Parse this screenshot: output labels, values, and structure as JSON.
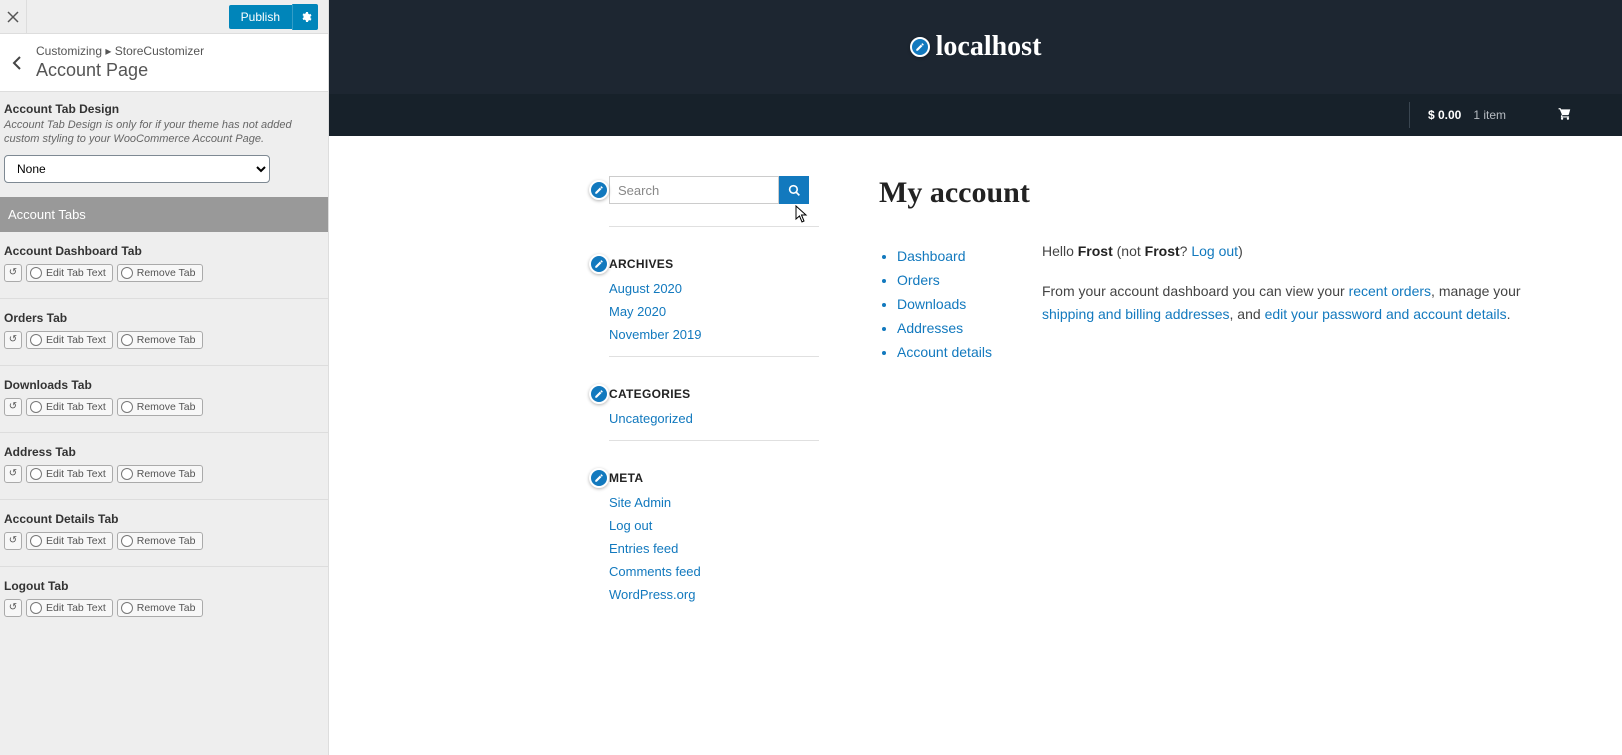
{
  "sidebar": {
    "publish": "Publish",
    "breadcrumb_prefix": "Customizing",
    "breadcrumb_section": "StoreCustomizer",
    "title": "Account Page",
    "design": {
      "label": "Account Tab Design",
      "desc": "Account Tab Design is only for if your theme has not added custom styling to your WooCommerce Account Page.",
      "value": "None"
    },
    "tabs_header": "Account Tabs",
    "edit_label": "Edit Tab Text",
    "remove_label": "Remove Tab",
    "tabs": [
      {
        "title": "Account Dashboard Tab"
      },
      {
        "title": "Orders Tab"
      },
      {
        "title": "Downloads Tab"
      },
      {
        "title": "Address Tab"
      },
      {
        "title": "Account Details Tab"
      },
      {
        "title": "Logout Tab"
      }
    ]
  },
  "site": {
    "name": "localhost",
    "cart_price": "$ 0.00",
    "cart_items": "1 item"
  },
  "widgets": {
    "search_placeholder": "Search",
    "archives": {
      "title": "ARCHIVES",
      "items": [
        "August 2020",
        "May 2020",
        "November 2019"
      ]
    },
    "categories": {
      "title": "CATEGORIES",
      "items": [
        "Uncategorized"
      ]
    },
    "meta": {
      "title": "META",
      "items": [
        "Site Admin",
        "Log out",
        "Entries feed",
        "Comments feed",
        "WordPress.org"
      ]
    }
  },
  "account": {
    "heading": "My account",
    "nav": [
      "Dashboard",
      "Orders",
      "Downloads",
      "Addresses",
      "Account details"
    ],
    "greeting_hello": "Hello ",
    "greeting_user": "Frost",
    "greeting_not": " (not ",
    "greeting_user2": "Frost",
    "greeting_q": "? ",
    "logout": "Log out",
    "greeting_end": ")",
    "p1": "From your account dashboard you can view your ",
    "l1": "recent orders",
    "p2": ", manage your ",
    "l2": "shipping and billing addresses",
    "p3": ", and ",
    "l3": "edit your password and account details",
    "p4": "."
  }
}
